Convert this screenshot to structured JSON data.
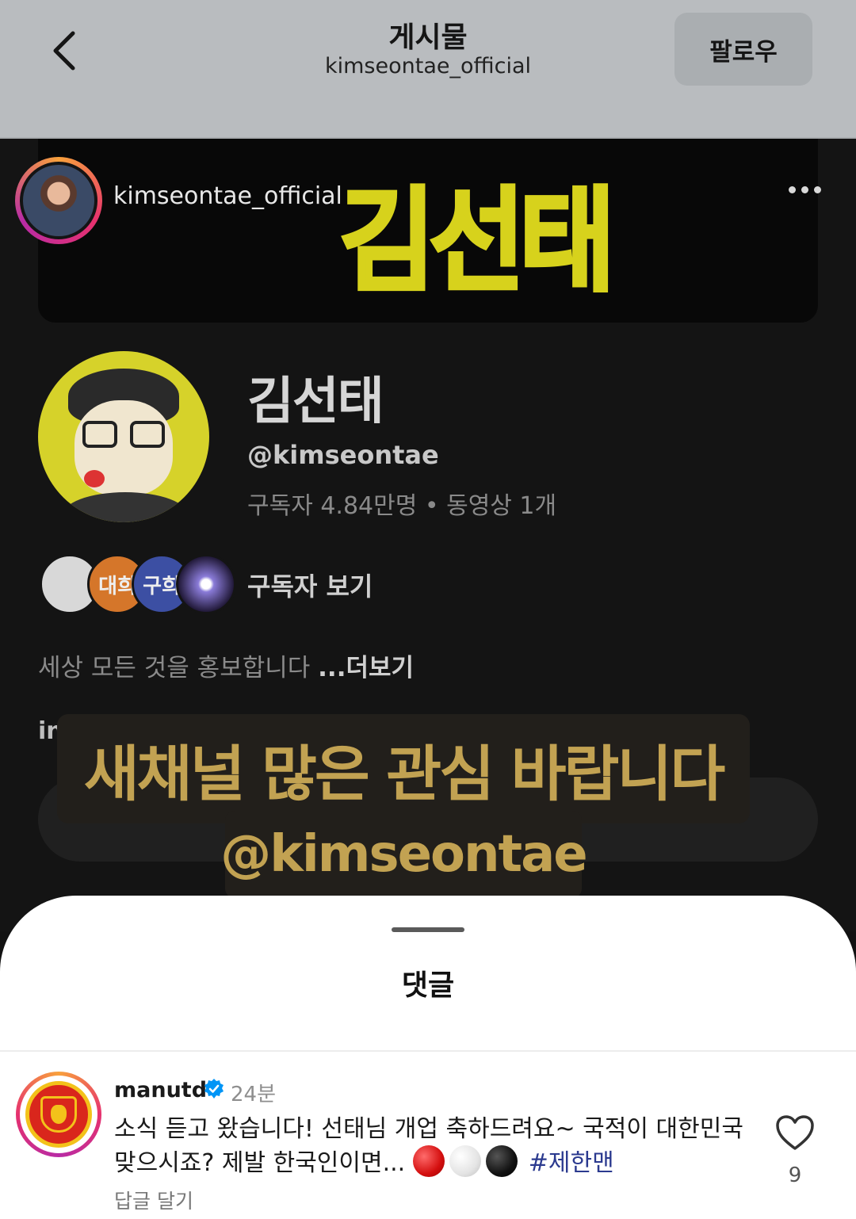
{
  "header": {
    "title": "게시물",
    "subtitle": "kimseontae_official",
    "follow_label": "팔로우"
  },
  "post": {
    "username": "kimseontae_official",
    "banner_logo": "김선태",
    "channel": {
      "name": "김선태",
      "handle": "@kimseontae",
      "stats": "구독자 4.84만명 • 동영상 1개",
      "subscriber_avatars": [
        "",
        "대희",
        "구희",
        ""
      ],
      "view_subscribers": "구독자 보기",
      "description": "세상 모든 것을 홍보합니다 ",
      "more": "...더보기",
      "link_fragment": "in"
    },
    "overlay_line1": "새채널 많은 관심 바랍니다",
    "overlay_line2": "@kimseontae"
  },
  "comments": {
    "title": "댓글",
    "items": [
      {
        "username": "manutd",
        "verified": true,
        "time": "24분",
        "text": "소식 듣고 왔습니다! 선태님 개업 축하드려요~ 국적이 대한민국 맞으시죠? 제발 한국인이면... ",
        "hashtag": "#제한맨",
        "reply_label": "답글 달기",
        "likes": "9"
      }
    ]
  },
  "colors": {
    "accent_gold": "#c2a252",
    "banner_yellow": "#d7d21c",
    "verified_blue": "#0095f6",
    "hashtag": "#2b3a8f"
  }
}
